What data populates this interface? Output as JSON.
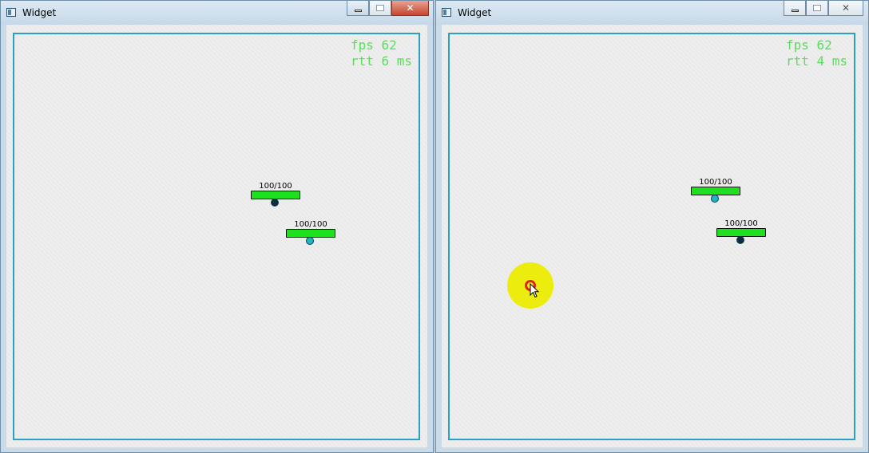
{
  "windows": [
    {
      "title": "Widget",
      "hud": {
        "fps": "fps 62",
        "rtt": "rtt 6 ms"
      },
      "players": [
        {
          "hp": "100/100",
          "dot_color": "#0b2d3f"
        },
        {
          "hp": "100/100",
          "dot_color": "#1fb6c2"
        }
      ]
    },
    {
      "title": "Widget",
      "hud": {
        "fps": "fps 62",
        "rtt": "rtt 4 ms"
      },
      "players": [
        {
          "hp": "100/100",
          "dot_color": "#1fb6c2"
        },
        {
          "hp": "100/100",
          "dot_color": "#0b2d3f"
        }
      ]
    }
  ],
  "colors": {
    "arena_border": "#2aa0c4",
    "hud_text": "#58e058",
    "hp_bar": "#1ee01e",
    "cursor_halo": "#ecec0f",
    "cursor_ring": "#e3221b"
  },
  "icons": {
    "app": "widget-app-icon",
    "minimize": "minimize-icon",
    "maximize": "maximize-icon",
    "close": "close-icon"
  }
}
